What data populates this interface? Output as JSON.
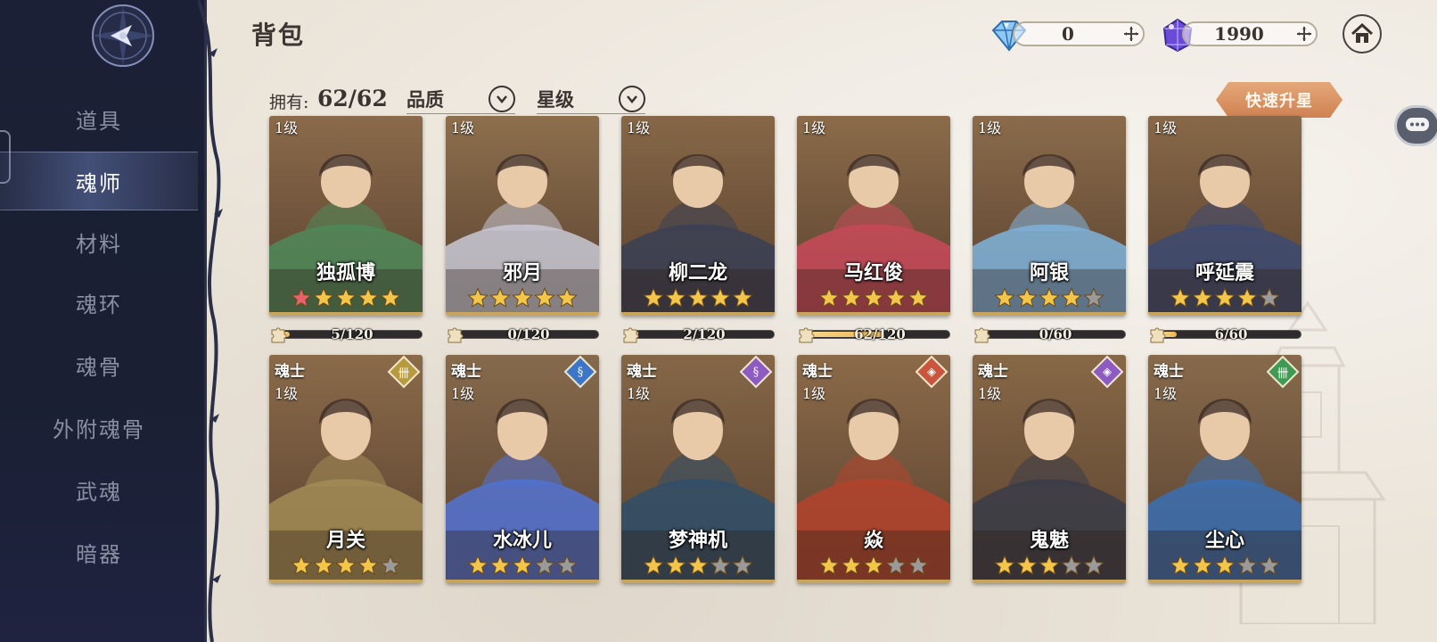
{
  "header": {
    "title": "背包",
    "currency_diamond": "0",
    "currency_crystal": "1990"
  },
  "sidebar": {
    "items": [
      {
        "label": "道具",
        "active": false
      },
      {
        "label": "魂师",
        "active": true
      },
      {
        "label": "材料",
        "active": false
      },
      {
        "label": "魂环",
        "active": false
      },
      {
        "label": "魂骨",
        "active": false
      },
      {
        "label": "外附魂骨",
        "active": false
      },
      {
        "label": "武魂",
        "active": false
      },
      {
        "label": "暗器",
        "active": false
      }
    ]
  },
  "filters": {
    "owned_label": "拥有:",
    "owned_count": "62/62",
    "quality_label": "品质",
    "star_label": "星级",
    "quick_star_button": "快速升星"
  },
  "cards_row1": [
    {
      "name": "独孤博",
      "level": "1级",
      "stars": 5,
      "red_stars": 1,
      "progress": "5/120",
      "fraction": 0.042,
      "bg": "#8a6a4a",
      "accent": "#4f8a5a"
    },
    {
      "name": "邪月",
      "level": "1级",
      "stars": 5,
      "red_stars": 0,
      "progress": "0/120",
      "fraction": 0,
      "bg": "#8d6f4d",
      "accent": "#c9c9d6"
    },
    {
      "name": "柳二龙",
      "level": "1级",
      "stars": 5,
      "red_stars": 0,
      "progress": "2/120",
      "fraction": 0.017,
      "bg": "#866747",
      "accent": "#3a3f55"
    },
    {
      "name": "马红俊",
      "level": "1级",
      "stars": 5,
      "red_stars": 0,
      "progress": "62/120",
      "fraction": 0.517,
      "bg": "#8b6b49",
      "accent": "#c84a5a"
    },
    {
      "name": "阿银",
      "level": "1级",
      "stars": 4,
      "red_stars": 0,
      "progress": "0/60",
      "fraction": 0,
      "bg": "#8a6b4b",
      "accent": "#7fb3dc"
    },
    {
      "name": "呼延震",
      "level": "1级",
      "stars": 4,
      "red_stars": 0,
      "progress": "6/60",
      "fraction": 0.1,
      "bg": "#876848",
      "accent": "#3c4a72"
    }
  ],
  "cards_row2": [
    {
      "name": "月关",
      "rank": "魂士",
      "level": "1级",
      "stars": 4,
      "badge_color": "#b79a3c",
      "badge_glyph": "卌",
      "bg": "#8a6a49",
      "accent": "#a28c55"
    },
    {
      "name": "水冰儿",
      "rank": "魂士",
      "level": "1级",
      "stars": 3,
      "badge_color": "#3b76c9",
      "badge_glyph": "§",
      "bg": "#866a4c",
      "accent": "#5273d4"
    },
    {
      "name": "梦神机",
      "rank": "魂士",
      "level": "1级",
      "stars": 3,
      "badge_color": "#8d5bc2",
      "badge_glyph": "§",
      "bg": "#856747",
      "accent": "#2f4f6a"
    },
    {
      "name": "焱",
      "rank": "魂士",
      "level": "1级",
      "stars": 3,
      "badge_color": "#c9553d",
      "badge_glyph": "◈",
      "bg": "#8b6a48",
      "accent": "#b4432d"
    },
    {
      "name": "鬼魅",
      "rank": "魂士",
      "level": "1级",
      "stars": 3,
      "badge_color": "#8d5bc2",
      "badge_glyph": "◈",
      "bg": "#876846",
      "accent": "#3a3c48"
    },
    {
      "name": "尘心",
      "rank": "魂士",
      "level": "1级",
      "stars": 3,
      "badge_color": "#3f9a53",
      "badge_glyph": "卌",
      "bg": "#876a4b",
      "accent": "#3a6fb3"
    }
  ]
}
